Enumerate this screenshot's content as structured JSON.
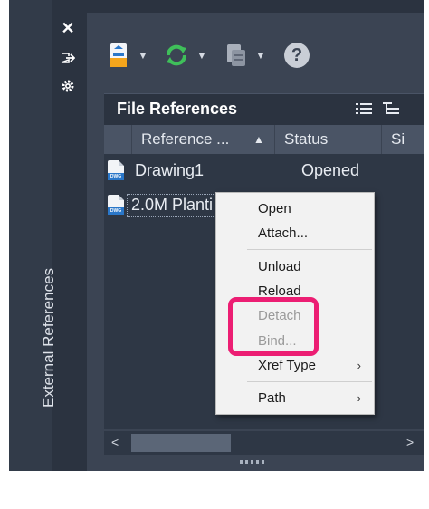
{
  "palette": {
    "title": "External References"
  },
  "side_icons": [
    {
      "name": "close-icon",
      "glyph": "✕"
    },
    {
      "name": "auto-hide-icon",
      "glyph": "⇥"
    },
    {
      "name": "properties-gear-icon",
      "glyph": "✱"
    }
  ],
  "toolbar": {
    "attach_icon": "attach-dwg-icon",
    "refresh_icon": "refresh-icon",
    "change_path_icon": "change-path-icon",
    "help_glyph": "?"
  },
  "file_references": {
    "title": "File References",
    "list_view_icon": "list-view-icon",
    "tree_view_icon": "tree-view-icon",
    "columns": [
      {
        "label": "Reference ...",
        "sort": "▲"
      },
      {
        "label": "Status"
      },
      {
        "label": "Si"
      }
    ],
    "rows": [
      {
        "name": "Drawing1",
        "status": "Opened",
        "badge": "DWG"
      },
      {
        "name": "2.0M Planti",
        "status": "",
        "badge": "DWG"
      }
    ]
  },
  "scrollbar": {
    "left_arrow": "<",
    "right_arrow": ">"
  },
  "context_menu": {
    "items": [
      {
        "label": "Open",
        "enabled": true
      },
      {
        "label": "Attach...",
        "enabled": true
      },
      {
        "label": "Unload",
        "enabled": true
      },
      {
        "label": "Reload",
        "enabled": true
      },
      {
        "label": "Detach",
        "enabled": false
      },
      {
        "label": "Bind...",
        "enabled": false
      },
      {
        "label": "Xref Type",
        "enabled": true,
        "submenu": "›"
      },
      {
        "label": "Path",
        "enabled": true,
        "submenu": "›"
      }
    ]
  },
  "colors": {
    "accent_highlight": "#ec1e73",
    "panel_bg": "#3b4453",
    "header_bg": "#2b3340",
    "refresh_green": "#3fbf5a",
    "dwg_blue": "#2a77c9"
  }
}
